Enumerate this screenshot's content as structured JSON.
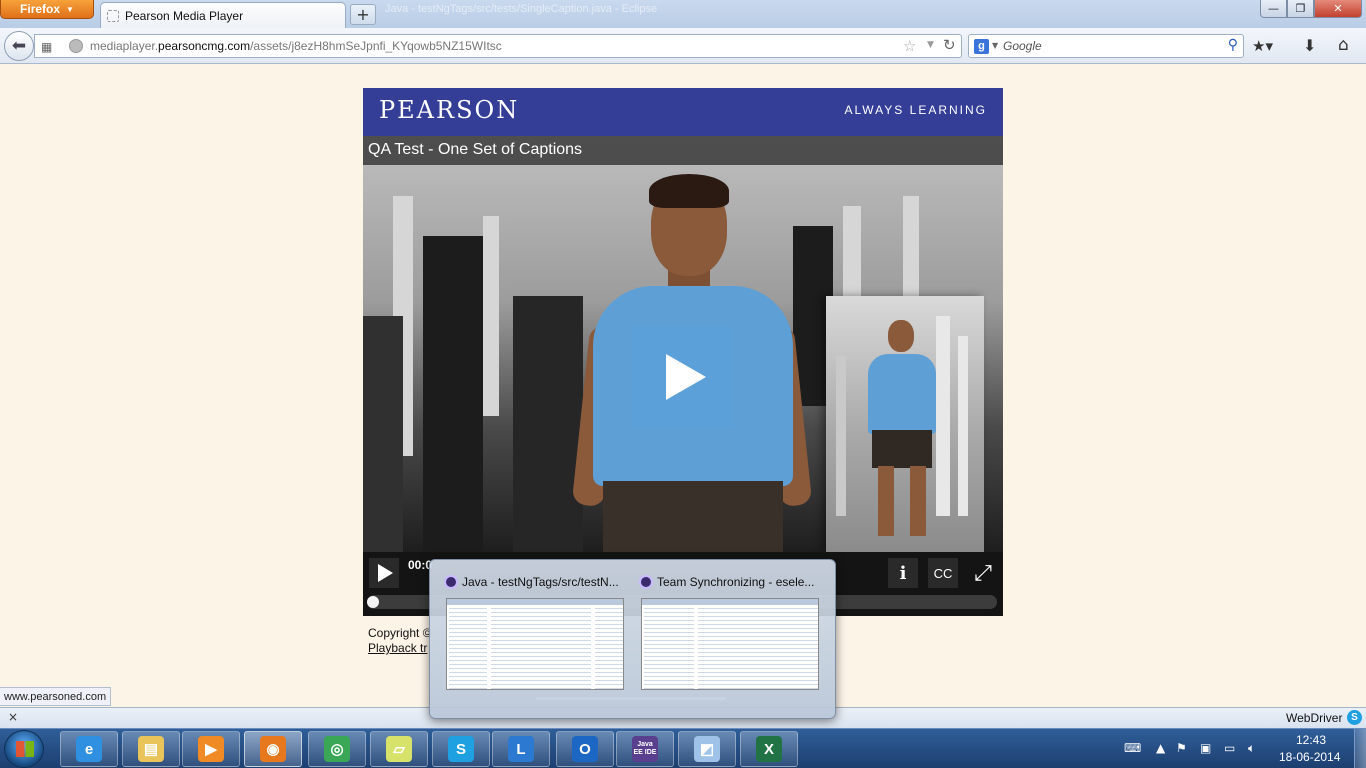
{
  "browser": {
    "menu_button": "Firefox",
    "ghost_window_title": "Java - testNgTags/src/tests/SingleCaption.java - Eclipse",
    "tab": {
      "title": "Pearson Media Player",
      "close": "×"
    },
    "new_tab": "+",
    "window_controls": {
      "minimize": "—",
      "maximize": "❐",
      "close": "✕"
    },
    "url_host_prefix": "mediaplayer.",
    "url_host_domain": "pearsoncmg.com",
    "url_path": "/assets/j8ezH8hmSeJpnfi_KYqowb5NZ15WItsc",
    "search": {
      "engine_icon": "g",
      "placeholder": "Google"
    }
  },
  "icons": {
    "back": "back-arrow-icon",
    "apps": "apps-icon",
    "site": "globe-icon",
    "bookmark_star": "star-icon",
    "reload": "reload-icon",
    "search": "magnifier-icon",
    "bookmarks_menu": "bookmarks-icon",
    "downloads": "download-icon",
    "home": "home-icon"
  },
  "player": {
    "brand": "PEARSON",
    "tagline": "ALWAYS LEARNING",
    "video_title": "QA Test - One Set of Captions",
    "time_display": "00:0",
    "info_label": "i",
    "cc_label": "CC",
    "fullscreen_glyph": "⤢",
    "progress_fraction": 0.0
  },
  "page": {
    "copyright": "Copyright ©",
    "playback_link": "Playback tr"
  },
  "status_bar": {
    "url": "www.pearsoned.com"
  },
  "addon_bar": {
    "close": "×",
    "webdriver_label": "WebDriver",
    "webdriver_icon": "S"
  },
  "thumbnail_popup": {
    "items": [
      {
        "title": "Java - testNgTags/src/testN..."
      },
      {
        "title": "Team Synchronizing - esele..."
      }
    ]
  },
  "taskbar": {
    "apps": [
      {
        "name": "internet-explorer",
        "glyph": "e",
        "color": "#2f8fe0"
      },
      {
        "name": "windows-explorer",
        "glyph": "▤",
        "color": "#e8c45a"
      },
      {
        "name": "media-player",
        "glyph": "▶",
        "color": "#f08a24"
      },
      {
        "name": "firefox",
        "glyph": "◉",
        "color": "#e8781e"
      },
      {
        "name": "chrome",
        "glyph": "◎",
        "color": "#3aa757"
      },
      {
        "name": "sticky-notes",
        "glyph": "▱",
        "color": "#d7e26a"
      },
      {
        "name": "skype",
        "glyph": "S",
        "color": "#1fa0e0"
      },
      {
        "name": "lync",
        "glyph": "L",
        "color": "#2b79d1"
      },
      {
        "name": "outlook",
        "glyph": "O",
        "color": "#1d67c4"
      },
      {
        "name": "eclipse-java-ee",
        "glyph": "Java EE IDE",
        "color": "#5b3f8f"
      },
      {
        "name": "notepad",
        "glyph": "◩",
        "color": "#9fc3e8"
      },
      {
        "name": "excel",
        "glyph": "X",
        "color": "#217346"
      }
    ],
    "clock_time": "12:43",
    "clock_date": "18-06-2014"
  }
}
